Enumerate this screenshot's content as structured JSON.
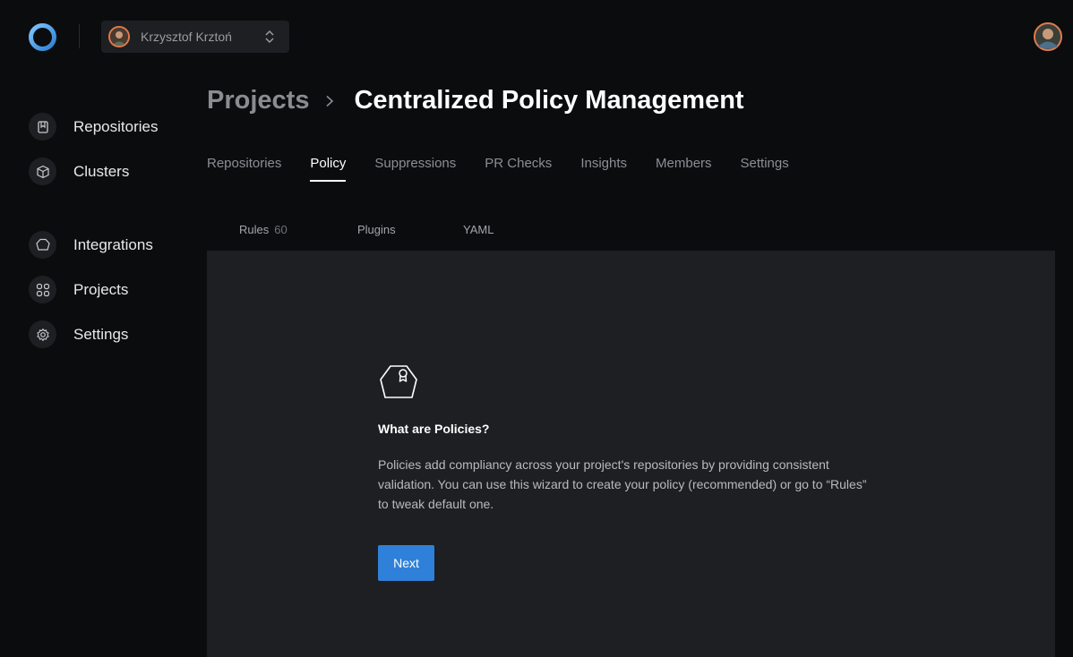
{
  "account": {
    "name": "Krzysztof Krztoń"
  },
  "sidebar": {
    "items": [
      {
        "label": "Repositories",
        "icon": "bookmark-icon"
      },
      {
        "label": "Clusters",
        "icon": "cube-icon"
      },
      {
        "label": "Integrations",
        "icon": "hexagon-icon"
      },
      {
        "label": "Projects",
        "icon": "grid-icon"
      },
      {
        "label": "Settings",
        "icon": "gear-icon"
      }
    ]
  },
  "breadcrumb": {
    "parent": "Projects",
    "current": "Centralized Policy Management"
  },
  "tabs": [
    {
      "label": "Repositories",
      "active": false
    },
    {
      "label": "Policy",
      "active": true
    },
    {
      "label": "Suppressions",
      "active": false
    },
    {
      "label": "PR Checks",
      "active": false
    },
    {
      "label": "Insights",
      "active": false
    },
    {
      "label": "Members",
      "active": false
    },
    {
      "label": "Settings",
      "active": false
    }
  ],
  "subtabs": [
    {
      "label": "Rules",
      "count": "60"
    },
    {
      "label": "Plugins"
    },
    {
      "label": "YAML"
    }
  ],
  "empty_state": {
    "title": "What are Policies?",
    "description": "Policies add compliancy across your project's repositories by providing consistent validation. You can use this wizard to create your policy (recommended) or go to “Rules” to tweak default one.",
    "button": "Next"
  },
  "colors": {
    "accent": "#2f80d8",
    "background": "#0b0c0e",
    "panel": "#1d1f22"
  }
}
